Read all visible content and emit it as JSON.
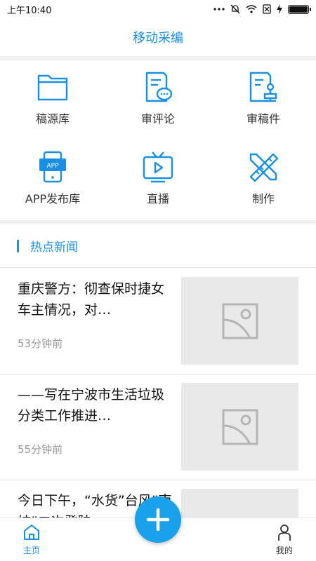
{
  "status_bar": {
    "time": "上午10:40"
  },
  "header": {
    "title": "移动采编"
  },
  "grid": [
    {
      "label": "稿源库",
      "icon": "folder-icon"
    },
    {
      "label": "审评论",
      "icon": "review-comment-icon"
    },
    {
      "label": "审稿件",
      "icon": "review-manuscript-icon"
    },
    {
      "label": "APP发布库",
      "icon": "app-publish-icon"
    },
    {
      "label": "直播",
      "icon": "live-tv-icon"
    },
    {
      "label": "制作",
      "icon": "ruler-pencil-icon"
    }
  ],
  "section": {
    "title": "热点新闻"
  },
  "news": [
    {
      "title": "重庆警方：彻查保时捷女车主情况，对…",
      "time": "53分钟前"
    },
    {
      "title": "——写在宁波市生活垃圾分类工作推进…",
      "time": "55分钟前"
    },
    {
      "title": "今日下午，“水货”台风“南坡”二次登陆…",
      "time": ""
    }
  ],
  "bottom_nav": {
    "home": "主页",
    "mine": "我的"
  },
  "colors": {
    "accent": "#1a8fe3",
    "fab": "#1aa1ec"
  }
}
